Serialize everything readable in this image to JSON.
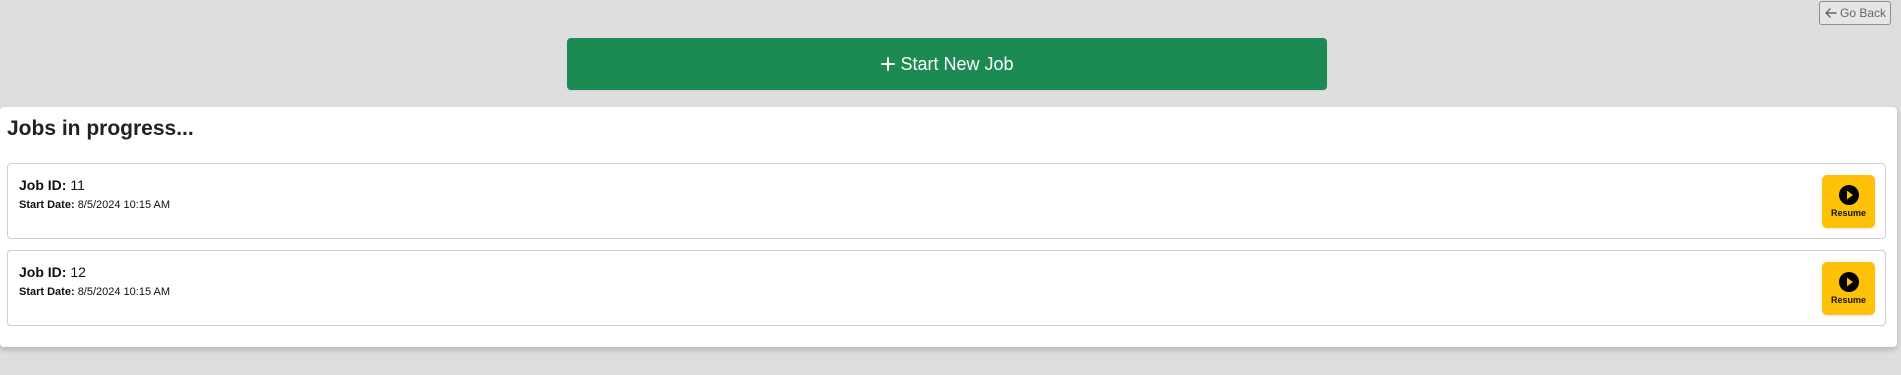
{
  "header": {
    "go_back_label": "Go Back",
    "go_back_icon": "arrow-left-icon",
    "start_job_label": "Start New Job",
    "start_job_icon": "plus-icon"
  },
  "jobs_panel": {
    "title": "Jobs in progress...",
    "job_id_label": "Job ID:",
    "start_date_label": "Start Date:",
    "resume_label": "Resume",
    "resume_icon": "play-circle-icon",
    "jobs": [
      {
        "id": "11",
        "start_date": "8/5/2024 10:15 AM"
      },
      {
        "id": "12",
        "start_date": "8/5/2024 10:15 AM"
      }
    ]
  },
  "colors": {
    "background": "#dedede",
    "primary_green": "#1b8a53",
    "resume_yellow": "#ffc107",
    "panel": "#ffffff"
  }
}
